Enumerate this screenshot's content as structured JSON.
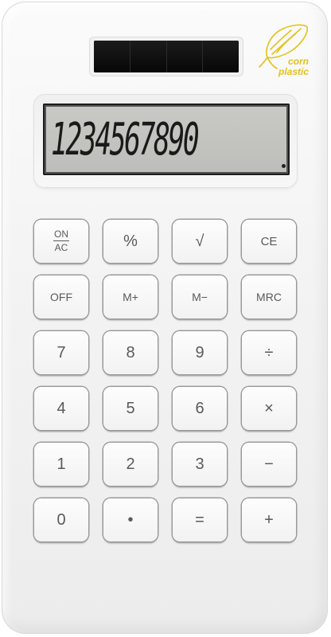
{
  "logo": {
    "line1": "corn",
    "line2": "plastic",
    "icon": "corn-cob-icon",
    "color": "#e3c21a"
  },
  "display": {
    "digits": "1234567890"
  },
  "keys": {
    "row1": [
      "%",
      "√",
      "CE"
    ],
    "onac": {
      "top": "ON",
      "bottom": "AC"
    },
    "row2": [
      "OFF",
      "M+",
      "M−",
      "MRC"
    ],
    "row3": [
      "7",
      "8",
      "9",
      "÷"
    ],
    "row4": [
      "4",
      "5",
      "6",
      "×"
    ],
    "row5": [
      "1",
      "2",
      "3",
      "−"
    ],
    "row6": [
      "0",
      "•",
      "=",
      "+"
    ]
  }
}
